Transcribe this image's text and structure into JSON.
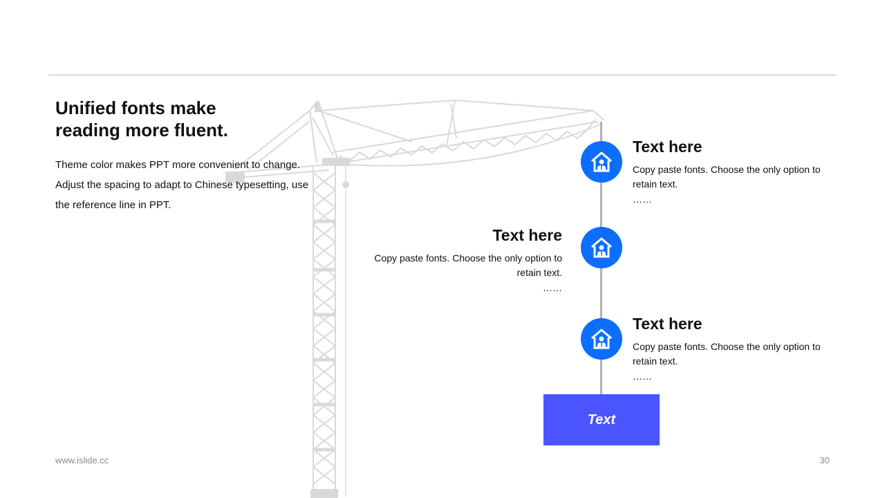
{
  "headline": {
    "line1": "Unified fonts make",
    "line2": "reading more fluent."
  },
  "body": {
    "line1": "Theme color makes PPT more convenient to change.",
    "line2": "Adjust the spacing to adapt to Chinese typesetting, use",
    "line3": "the reference line in PPT."
  },
  "timeline": {
    "items": [
      {
        "title": "Text here",
        "desc": "Copy paste fonts. Choose the only option to retain text.",
        "ellipsis": "……"
      },
      {
        "title": "Text here",
        "desc": "Copy paste fonts. Choose the only option to retain text.",
        "ellipsis": "……"
      },
      {
        "title": "Text here",
        "desc": "Copy paste fonts. Choose the only option to retain text.",
        "ellipsis": "……"
      }
    ],
    "node_icon": "house-person-icon",
    "cta_label": "Text"
  },
  "footer": {
    "website": "www.islide.cc",
    "page_number": "30"
  },
  "colors": {
    "node": "#0d6efd",
    "cta": "#4b55ff",
    "crane": "#d9d9d9",
    "rule": "#b8b8b8"
  }
}
